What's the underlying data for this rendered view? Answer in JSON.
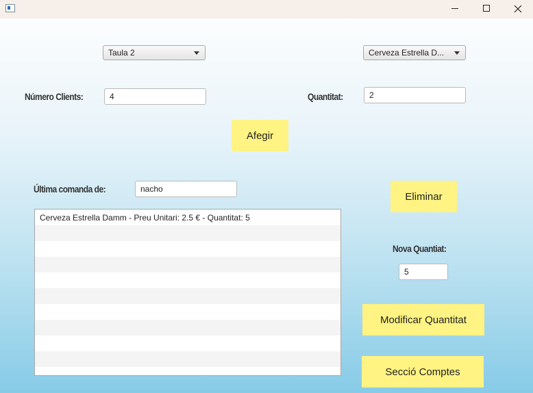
{
  "window": {
    "icon": "app-window-icon",
    "controls": [
      "minimize-icon",
      "maximize-icon",
      "close-icon"
    ]
  },
  "form": {
    "table_select": "Taula 2",
    "product_select": "Cerveza Estrella D...",
    "clients_label": "Número Clients:",
    "clients_value": "4",
    "quantity_label": "Quantitat:",
    "quantity_value": "2",
    "add_button": "Afegir"
  },
  "order": {
    "last_order_label": "Última comanda de:",
    "last_order_value": "nacho",
    "items": [
      "Cerveza Estrella Damm - Preu Unitari: 2.5 € - Quantitat: 5",
      "",
      "",
      "",
      "",
      "",
      "",
      "",
      "",
      "",
      ""
    ]
  },
  "actions": {
    "delete_button": "Eliminar",
    "new_quantity_label": "Nova Quantiat:",
    "new_quantity_value": "5",
    "modify_button": "Modificar Quantitat",
    "accounts_button": "Secció Comptes"
  }
}
